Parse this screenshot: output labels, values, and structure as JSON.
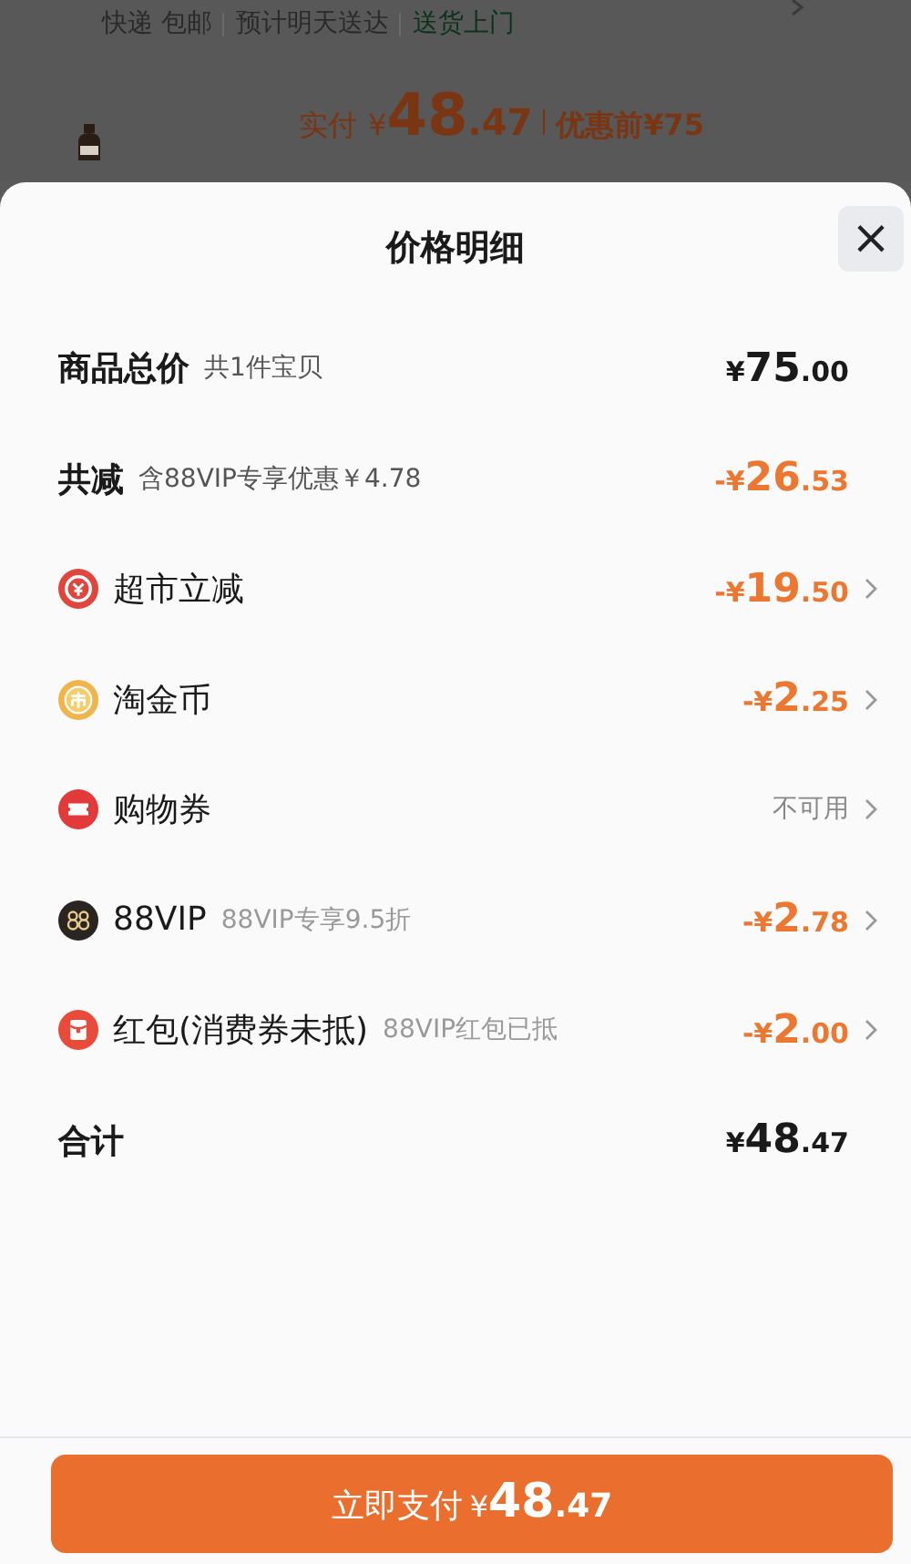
{
  "background_page": {
    "delivery": [
      {
        "text": "快递 包邮",
        "kind": "plain"
      },
      {
        "text": "预计明天送达",
        "kind": "plain"
      },
      {
        "text": "送货上门",
        "kind": "highlight"
      }
    ],
    "paid_label": "实付",
    "paid_amount": "¥48.47",
    "original_price": "优惠前¥75",
    "kind": "picture"
  },
  "sheet": {
    "title": "价格明细",
    "close": "×",
    "rows": [
      {
        "kind": "total",
        "label": "商品总价",
        "note": "共1件宝贝",
        "amount": "¥75.00",
        "arrow": false
      },
      {
        "kind": "reduction",
        "label": "共减",
        "note": "含88VIP专享优惠￥4.78",
        "amount": "-¥26.53",
        "arrow": false
      },
      {
        "kind": "market",
        "label": "超市立减",
        "amount": "-¥19.50",
        "arrow": true
      },
      {
        "kind": "coin",
        "label": "淘金币",
        "amount": "-¥2.25",
        "arrow": true
      },
      {
        "kind": "ticket",
        "label": "购物券",
        "amount": "不可用",
        "arrow": true
      },
      {
        "kind": "vip",
        "label": "88VIP",
        "note": "88VIP专享9.5折",
        "amount": "-¥2.78",
        "arrow": true
      },
      {
        "kind": "packet",
        "label": "红包(消费券未抵)",
        "note": "88VIP红包已抵",
        "amount": "-¥2.00",
        "arrow": true
      },
      {
        "kind": "total",
        "label": "合计",
        "amount": "¥48.47",
        "arrow": false
      }
    ],
    "pay_button": {
      "label": "立即支付",
      "amount": "¥48.47"
    }
  }
}
